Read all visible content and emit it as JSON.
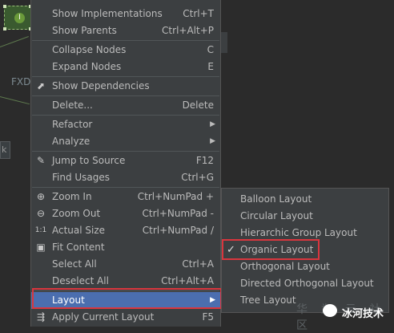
{
  "canvas": {
    "node_icon_glyph": "I",
    "label_fxdi": "FXDi",
    "label_k": "k"
  },
  "context_menu": {
    "groups": [
      [
        {
          "label": "Show Implementations",
          "shortcut": "Ctrl+T",
          "icon": ""
        },
        {
          "label": "Show Parents",
          "shortcut": "Ctrl+Alt+P",
          "icon": ""
        }
      ],
      [
        {
          "label": "Collapse Nodes",
          "shortcut": "C",
          "icon": ""
        },
        {
          "label": "Expand Nodes",
          "shortcut": "E",
          "icon": ""
        }
      ],
      [
        {
          "label": "Show Dependencies",
          "shortcut": "",
          "icon": "dependencies-icon"
        }
      ],
      [
        {
          "label": "Delete...",
          "shortcut": "Delete",
          "icon": ""
        }
      ],
      [
        {
          "label": "Refactor",
          "shortcut": "",
          "icon": "",
          "submenu": true
        },
        {
          "label": "Analyze",
          "shortcut": "",
          "icon": "",
          "submenu": true
        }
      ],
      [
        {
          "label": "Jump to Source",
          "shortcut": "F12",
          "icon": "pencil-icon"
        },
        {
          "label": "Find Usages",
          "shortcut": "Ctrl+G",
          "icon": ""
        }
      ],
      [
        {
          "label": "Zoom In",
          "shortcut": "Ctrl+NumPad +",
          "icon": "zoom-in-icon"
        },
        {
          "label": "Zoom Out",
          "shortcut": "Ctrl+NumPad -",
          "icon": "zoom-out-icon"
        },
        {
          "label": "Actual Size",
          "shortcut": "Ctrl+NumPad /",
          "icon": "actual-size-icon"
        },
        {
          "label": "Fit Content",
          "shortcut": "",
          "icon": "fit-content-icon"
        },
        {
          "label": "Select All",
          "shortcut": "Ctrl+A",
          "icon": ""
        },
        {
          "label": "Deselect All",
          "shortcut": "Ctrl+Alt+A",
          "icon": ""
        }
      ],
      [
        {
          "label": "Layout",
          "shortcut": "",
          "icon": "",
          "submenu": true,
          "selected": true
        },
        {
          "label": "Apply Current Layout",
          "shortcut": "F5",
          "icon": "apply-layout-icon"
        }
      ]
    ],
    "icon_glyphs": {
      "dependencies-icon": "⬈",
      "pencil-icon": "✎",
      "zoom-in-icon": "⊕",
      "zoom-out-icon": "⊖",
      "actual-size-icon": "1:1",
      "fit-content-icon": "▣",
      "apply-layout-icon": "⇶"
    },
    "submenu_arrow": "▶"
  },
  "layout_submenu": {
    "items": [
      {
        "label": "Balloon Layout",
        "checked": false
      },
      {
        "label": "Circular Layout",
        "checked": false
      },
      {
        "label": "Hierarchic Group Layout",
        "checked": false
      },
      {
        "label": "Organic Layout",
        "checked": true
      },
      {
        "label": "Orthogonal Layout",
        "checked": false
      },
      {
        "label": "Directed Orthogonal Layout",
        "checked": false
      },
      {
        "label": "Tree Layout",
        "checked": false
      }
    ],
    "check_glyph": "✓"
  },
  "watermark": {
    "faint_text": "华 为 云 社 区",
    "brand_text": "冰河技术"
  },
  "colors": {
    "menu_bg": "#3c3f41",
    "selected_bg": "#4b6eaf",
    "highlight_box": "#d9363e",
    "text": "#bbbbbb"
  }
}
